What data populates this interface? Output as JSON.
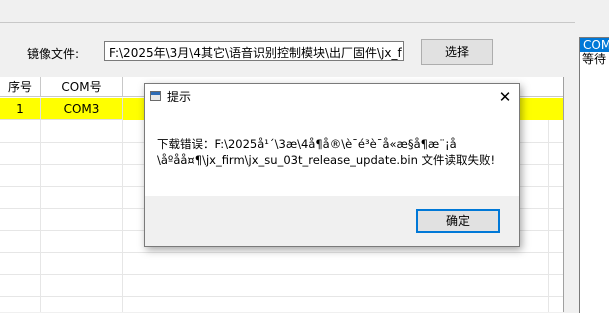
{
  "main": {
    "file_label": "镜像文件:",
    "file_path": "F:\\2025年\\3月\\4其它\\语音识别控制模块\\出厂固件\\jx_f",
    "select_button": "选择"
  },
  "grid": {
    "headers": [
      "序号",
      "COM号"
    ],
    "rows": [
      {
        "index": "1",
        "com": "COM3"
      }
    ],
    "highlight_color": "#ffff00"
  },
  "side_panel": {
    "line1": "COM",
    "line2": "等待"
  },
  "dialog": {
    "title": "提示",
    "message_line1": "下载错误：F:\\2025å¹´\\3æ\\4å¶å®\\è¯­é³è¯å«æ§å¶æ¨¡å",
    "message_line2": "\\åºåå¤¶\\jx_firm\\jx_su_03t_release_update.bin 文件读取失败!",
    "ok_button": "确定",
    "close_glyph": "✕"
  },
  "colors": {
    "accent": "#0078d7",
    "highlight": "#ffff00"
  }
}
